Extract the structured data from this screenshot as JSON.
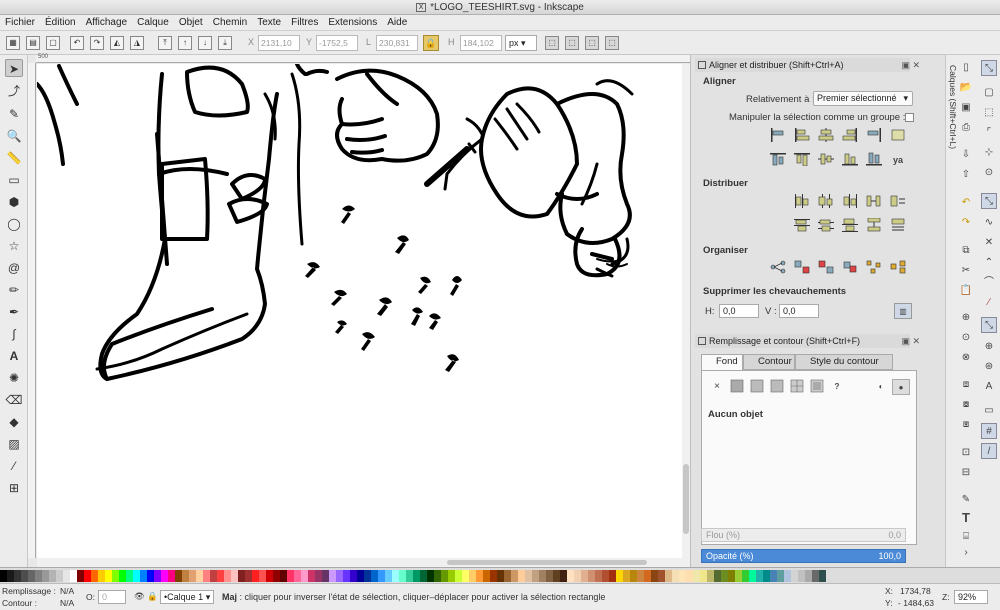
{
  "window": {
    "title": "*LOGO_TEESHIRT.svg - Inkscape",
    "app_icon": "X"
  },
  "menu": [
    "Fichier",
    "Édition",
    "Affichage",
    "Calque",
    "Objet",
    "Chemin",
    "Texte",
    "Filtres",
    "Extensions",
    "Aide"
  ],
  "toolbar": {
    "x_label": "X",
    "x_value": "2131,10",
    "y_label": "Y",
    "y_value": "-1752,5",
    "l_label": "L",
    "l_value": "230,831",
    "h_label": "H",
    "h_value": "184,102",
    "unit": "px"
  },
  "align_panel": {
    "title": "Aligner et distribuer (Shift+Ctrl+A)",
    "section_align": "Aligner",
    "relative_label": "Relativement à :",
    "relative_value": "Premier sélectionné",
    "group_label": "Manipuler la sélection comme un groupe :",
    "section_distribute": "Distribuer",
    "section_organize": "Organiser",
    "section_overlap": "Supprimer les chevauchements",
    "h_label": "H:",
    "h_value": "0,0",
    "v_label": "V :",
    "v_value": "0,0",
    "text_icon": "ya"
  },
  "fill_panel": {
    "title": "Remplissage et contour (Shift+Ctrl+F)",
    "tabs": [
      "Fond",
      "Contour",
      "Style du contour"
    ],
    "none_glyph": "×",
    "unknown_glyph": "?",
    "status": "Aucun objet",
    "blur_label": "Flou (%)",
    "blur_value": "0,0",
    "opacity_label": "Opacité (%)",
    "opacity_value": "100,0"
  },
  "layers_tab": "Calques (Shift+Ctrl+L)",
  "ruler_mark": "500",
  "statusbar": {
    "fill_label": "Remplissage :",
    "fill_value": "N/A",
    "stroke_label": "Contour :",
    "stroke_value": "N/A",
    "o_label": "O:",
    "o_value": "0",
    "layer": "•Calque 1",
    "message_bold": "Maj",
    "message": " : cliquer pour inverser l'état de sélection, cliquer–déplacer pour activer la sélection rectangle",
    "x_label": "X:",
    "x_value": "1734,78",
    "y_label": "Y:",
    "y_value": "- 1484,63",
    "z_label": "Z:",
    "zoom": "92%"
  },
  "palette_colors": [
    "#000000",
    "#1a1a1a",
    "#333333",
    "#4d4d4d",
    "#666666",
    "#808080",
    "#999999",
    "#b3b3b3",
    "#cccccc",
    "#e6e6e6",
    "#ffffff",
    "#800000",
    "#ff0000",
    "#ff6600",
    "#ffcc00",
    "#ffff00",
    "#80ff00",
    "#00ff00",
    "#00ff80",
    "#00ffff",
    "#0080ff",
    "#0000ff",
    "#8000ff",
    "#ff00ff",
    "#ff0080",
    "#804000",
    "#c08040",
    "#e0a070",
    "#ffd0a0",
    "#ff8080",
    "#c04040",
    "#ff4040",
    "#ff9090",
    "#ffc0c0",
    "#802020",
    "#a03030",
    "#ff2020",
    "#ff5050",
    "#d00000",
    "#900000",
    "#600000",
    "#ff3366",
    "#ff6699",
    "#ff99cc",
    "#cc3366",
    "#993366",
    "#663366",
    "#cc99ff",
    "#9966ff",
    "#6633ff",
    "#3300cc",
    "#000099",
    "#003399",
    "#0066cc",
    "#3399ff",
    "#66ccff",
    "#99ffff",
    "#66ffcc",
    "#33cc99",
    "#009966",
    "#006633",
    "#003300",
    "#336600",
    "#669900",
    "#99cc00",
    "#ccff33",
    "#ffff66",
    "#ffcc66",
    "#ff9933",
    "#cc6600",
    "#993300",
    "#663300",
    "#996633",
    "#cc9966",
    "#ffcc99",
    "#e0c0a0",
    "#c0a080",
    "#a08060",
    "#806040",
    "#604020",
    "#402010",
    "#ffe0c0",
    "#f0d0b0",
    "#e0b090",
    "#d09070",
    "#c07050",
    "#b05030",
    "#a03010",
    "#ffd700",
    "#daa520",
    "#b8860b",
    "#cd853f",
    "#d2691e",
    "#8b4513",
    "#a0522d",
    "#deb887",
    "#f5deb3",
    "#ffe4b5",
    "#ffdead",
    "#eee8aa",
    "#f0e68c",
    "#bdb76b",
    "#556b2f",
    "#6b8e23",
    "#808000",
    "#9acd32",
    "#32cd32",
    "#00fa9a",
    "#20b2aa",
    "#008b8b",
    "#4682b4",
    "#5f9ea0",
    "#b0c4de",
    "#d3d3d3",
    "#c0c0c0",
    "#a9a9a9",
    "#696969",
    "#2f4f4f"
  ]
}
